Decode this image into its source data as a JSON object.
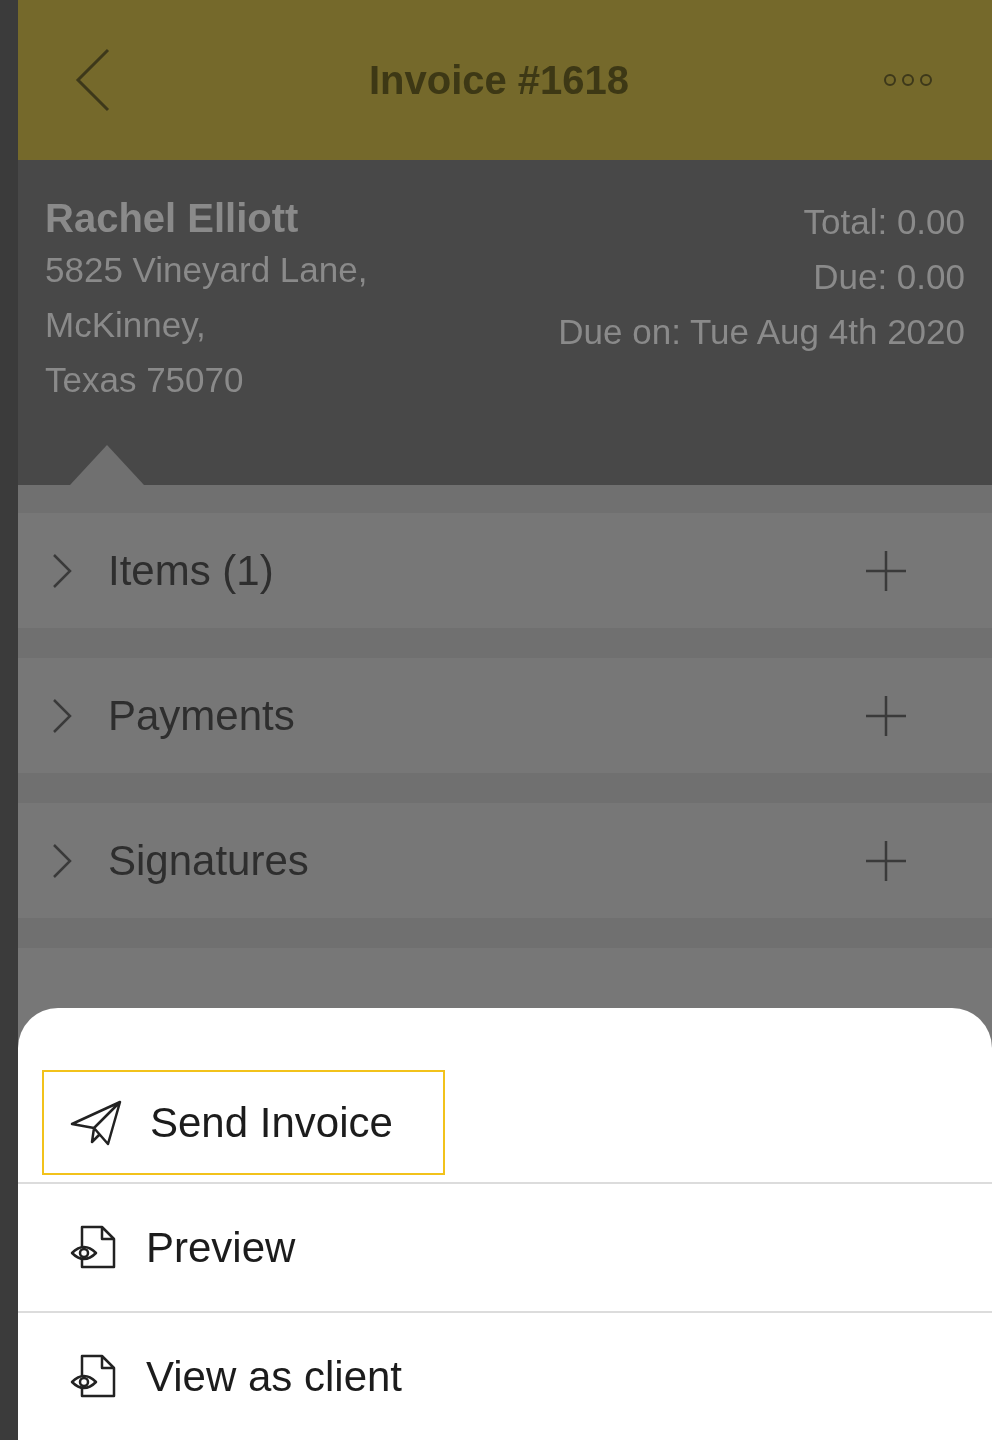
{
  "header": {
    "title": "Invoice #1618"
  },
  "client": {
    "name": "Rachel Elliott",
    "address_lines": [
      "5825 Vineyard Lane,",
      "McKinney,",
      "Texas 75070"
    ]
  },
  "totals": [
    "Total: 0.00",
    "Due: 0.00",
    "Due on: Tue Aug 4th 2020"
  ],
  "sections": [
    {
      "label": "Items (1)",
      "expanded": false
    },
    {
      "label": "Payments",
      "expanded": false
    },
    {
      "label": "Signatures",
      "expanded": false
    }
  ],
  "actions": [
    {
      "kind": "send",
      "label": "Send Invoice",
      "selected": true
    },
    {
      "kind": "preview",
      "label": "Preview",
      "selected": false
    },
    {
      "kind": "preview",
      "label": "View as client",
      "selected": false
    }
  ]
}
